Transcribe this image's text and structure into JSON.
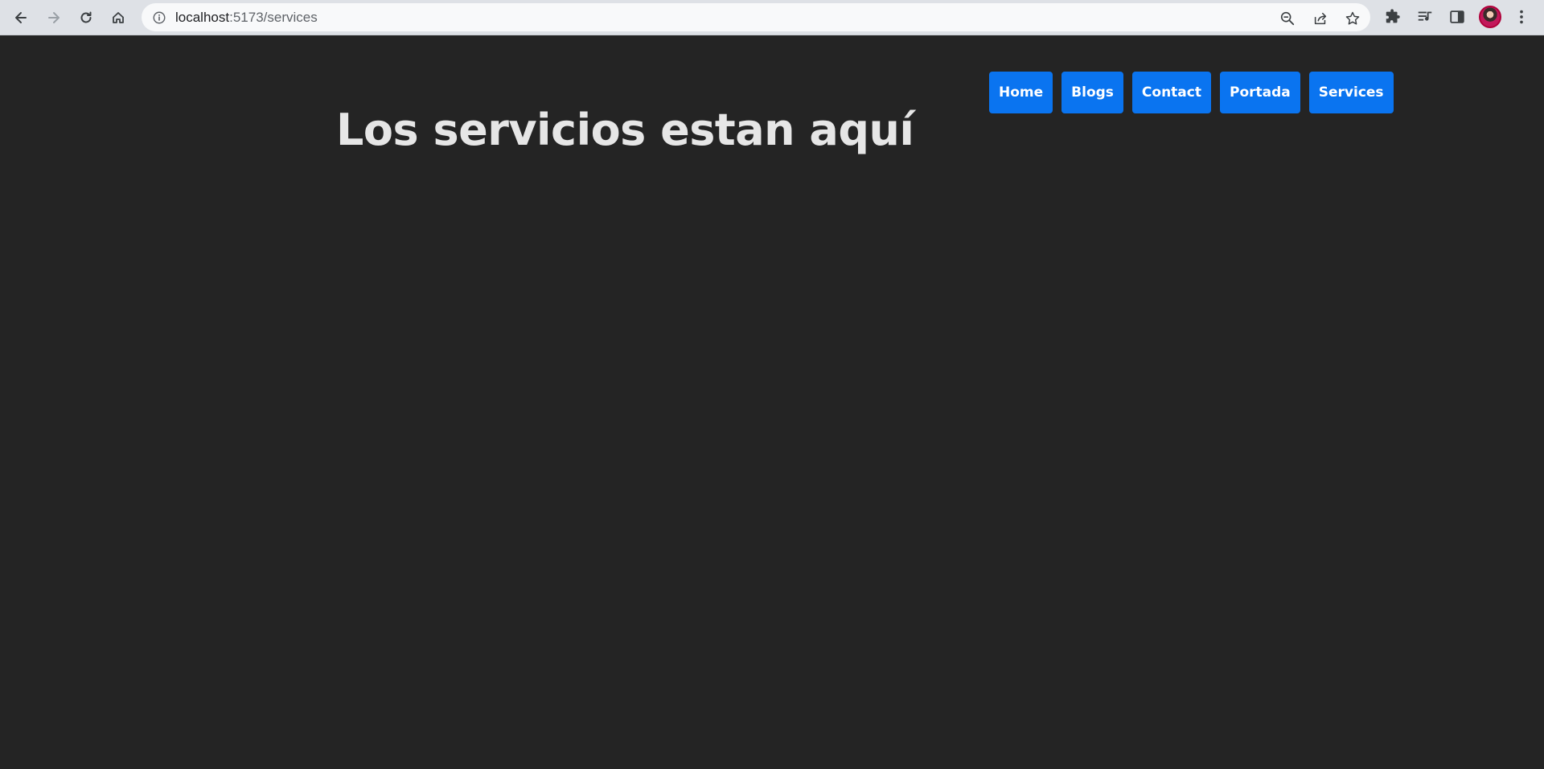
{
  "browser": {
    "url_host": "localhost",
    "url_path": ":5173/services",
    "icons": {
      "back": "back-arrow-icon",
      "forward": "forward-arrow-icon",
      "reload": "reload-icon",
      "home": "home-icon",
      "site_info": "info-icon",
      "zoom": "zoom-icon",
      "share": "share-icon",
      "bookmark": "star-icon",
      "extensions": "puzzle-icon",
      "media": "media-queue-icon",
      "side_panel": "side-panel-icon",
      "menu": "kebab-menu-icon"
    }
  },
  "page": {
    "title": "Los servicios estan aquí",
    "nav": [
      {
        "label": "Home"
      },
      {
        "label": "Blogs"
      },
      {
        "label": "Contact"
      },
      {
        "label": "Portada"
      },
      {
        "label": "Services"
      }
    ]
  },
  "colors": {
    "background": "#242424",
    "button": "#0a74f0",
    "title_text": "#e6e6e6"
  }
}
